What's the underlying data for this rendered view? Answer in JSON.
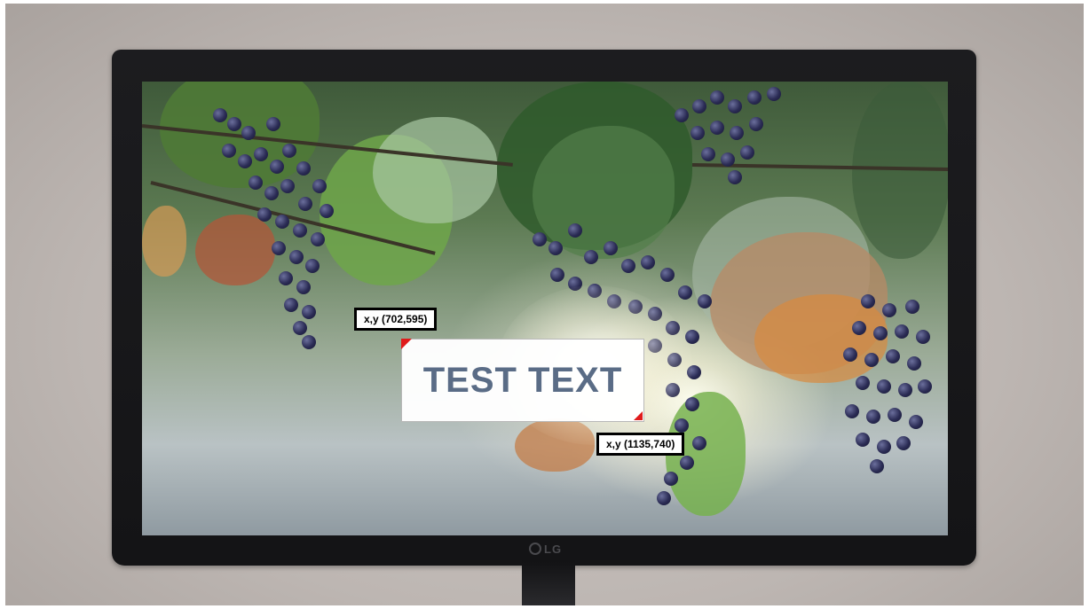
{
  "scene": {
    "description_color_wall": "#bdb6b2",
    "monitor_color": "#161618",
    "accent_marker_color": "#e01b1b"
  },
  "monitor": {
    "brand": "LG"
  },
  "screen": {
    "overlay_text": "TEST TEXT",
    "top_left_label": "x,y (702,595)",
    "bottom_right_label": "x,y (1135,740)"
  }
}
